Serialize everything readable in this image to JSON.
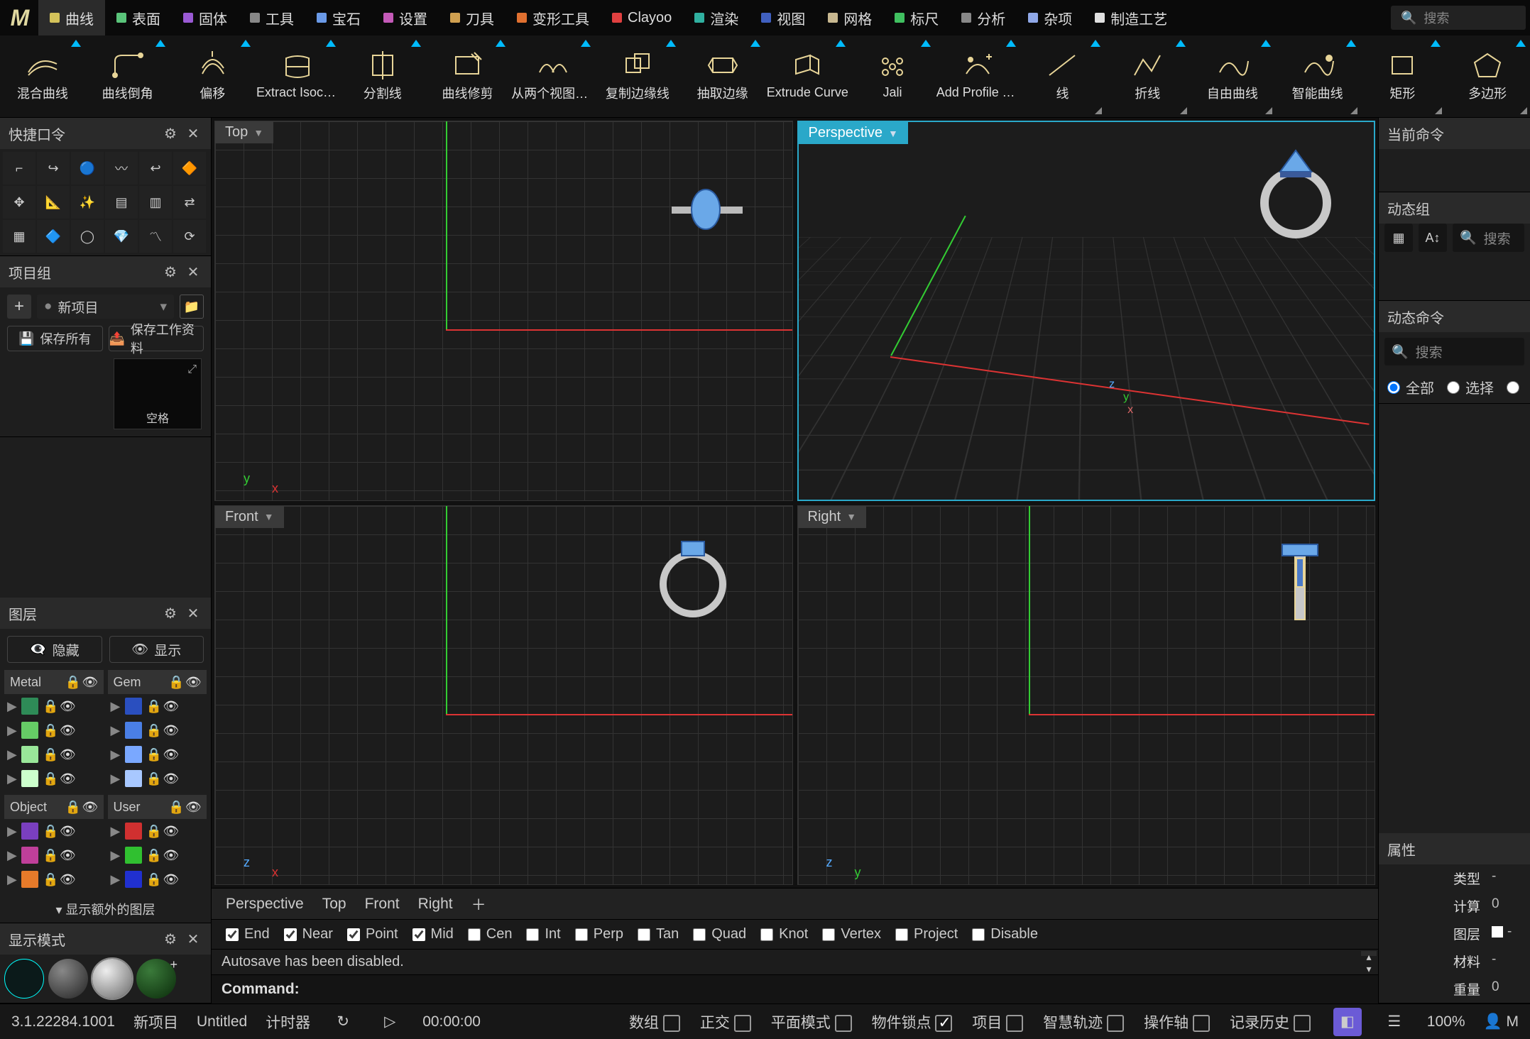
{
  "menu": {
    "items": [
      {
        "label": "曲线",
        "color": "#d4c25a",
        "active": true
      },
      {
        "label": "表面",
        "color": "#5ac47a"
      },
      {
        "label": "固体",
        "color": "#9a5ad4"
      },
      {
        "label": "工具",
        "color": "#888"
      },
      {
        "label": "宝石",
        "color": "#6a9ae8"
      },
      {
        "label": "设置",
        "color": "#c45ab8"
      },
      {
        "label": "刀具",
        "color": "#d0a050"
      },
      {
        "label": "变形工具",
        "color": "#e07030"
      },
      {
        "label": "Clayoo",
        "color": "#e04040"
      },
      {
        "label": "渲染",
        "color": "#30b0a0"
      },
      {
        "label": "视图",
        "color": "#4060c0"
      },
      {
        "label": "网格",
        "color": "#c8b890"
      },
      {
        "label": "标尺",
        "color": "#40c060"
      },
      {
        "label": "分析",
        "color": "#888"
      },
      {
        "label": "杂项",
        "color": "#90a8e8"
      },
      {
        "label": "制造工艺",
        "color": "#e0e0e0"
      }
    ],
    "search_placeholder": "搜索"
  },
  "ribbon": [
    {
      "label": "混合曲线"
    },
    {
      "label": "曲线倒角"
    },
    {
      "label": "偏移"
    },
    {
      "label": "Extract Isocurve Fr..."
    },
    {
      "label": "分割线"
    },
    {
      "label": "曲线修剪"
    },
    {
      "label": "从两个视图的曲线"
    },
    {
      "label": "复制边缘线"
    },
    {
      "label": "抽取边缘"
    },
    {
      "label": "Extrude Curve"
    },
    {
      "label": "Jali"
    },
    {
      "label": "Add Profile To Libr..."
    },
    {
      "label": "线",
      "corner": true
    },
    {
      "label": "折线",
      "corner": true
    },
    {
      "label": "自由曲线",
      "corner": true
    },
    {
      "label": "智能曲线",
      "corner": true
    },
    {
      "label": "矩形",
      "corner": true
    },
    {
      "label": "多边形",
      "corner": true
    }
  ],
  "left": {
    "quick_title": "快捷口令",
    "project_title": "项目组",
    "new_project": "新项目",
    "save_all": "保存所有",
    "save_work": "保存工作资料",
    "thumb_label": "空格",
    "layers_title": "图层",
    "hide": "隐藏",
    "show": "显示",
    "metal": "Metal",
    "gem": "Gem",
    "object": "Object",
    "user": "User",
    "metal_colors": [
      "#2e8b57",
      "#66cc66",
      "#99e699",
      "#ccffcc"
    ],
    "gem_colors": [
      "#2a4fbf",
      "#4a7fe6",
      "#7aa8ff",
      "#a8c8ff"
    ],
    "object_colors": [
      "#7a3fbf",
      "#bf3f9a",
      "#e67a2a"
    ],
    "user_colors": [
      "#d03030",
      "#30c030",
      "#2030d0"
    ],
    "show_more": "显示额外的图层",
    "display_title": "显示模式"
  },
  "viewports": {
    "top": "Top",
    "perspective": "Perspective",
    "front": "Front",
    "right": "Right",
    "tabs": [
      "Perspective",
      "Top",
      "Front",
      "Right"
    ],
    "snaps": [
      {
        "label": "End",
        "on": true
      },
      {
        "label": "Near",
        "on": true
      },
      {
        "label": "Point",
        "on": true
      },
      {
        "label": "Mid",
        "on": true
      },
      {
        "label": "Cen",
        "on": false
      },
      {
        "label": "Int",
        "on": false
      },
      {
        "label": "Perp",
        "on": false
      },
      {
        "label": "Tan",
        "on": false
      },
      {
        "label": "Quad",
        "on": false
      },
      {
        "label": "Knot",
        "on": false
      },
      {
        "label": "Vertex",
        "on": false
      },
      {
        "label": "Project",
        "on": false
      },
      {
        "label": "Disable",
        "on": false
      }
    ],
    "log": "Autosave has been disabled.",
    "cmd_label": "Command:"
  },
  "right": {
    "current_cmd": "当前命令",
    "dyn_group": "动态组",
    "search": "搜索",
    "dyn_cmd": "动态命令",
    "all": "全部",
    "select": "选择",
    "props_title": "属性",
    "props": [
      {
        "k": "类型",
        "v": "-"
      },
      {
        "k": "计算",
        "v": "0"
      },
      {
        "k": "图层",
        "v": "-"
      },
      {
        "k": "材料",
        "v": "-"
      },
      {
        "k": "重量",
        "v": "0"
      }
    ]
  },
  "status": {
    "version": "3.1.22284.1001",
    "new": "新项目",
    "file": "Untitled",
    "timer": "计时器",
    "time": "00:00:00",
    "items": [
      {
        "label": "数组",
        "on": false
      },
      {
        "label": "正交",
        "on": false
      },
      {
        "label": "平面模式",
        "on": false
      },
      {
        "label": "物件锁点",
        "on": true
      },
      {
        "label": "项目",
        "on": false
      },
      {
        "label": "智慧轨迹",
        "on": false
      },
      {
        "label": "操作轴",
        "on": false
      },
      {
        "label": "记录历史",
        "on": false
      }
    ],
    "zoom": "100%",
    "user": "M"
  }
}
